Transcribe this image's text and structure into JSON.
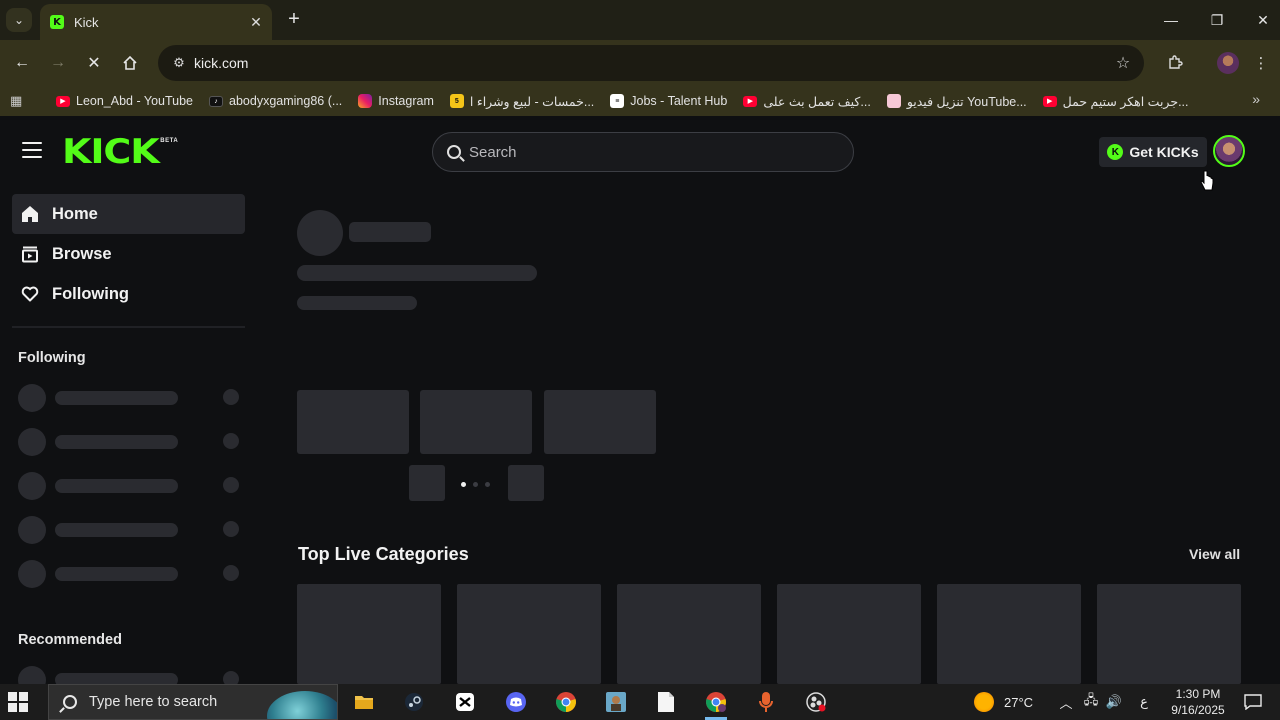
{
  "browser": {
    "tab_title": "Kick",
    "url": "kick.com",
    "bookmarks": [
      {
        "label": "Leon_Abd - YouTube",
        "icon": "youtube-icon"
      },
      {
        "label": "abodyxgaming86 (...",
        "icon": "tiktok-icon"
      },
      {
        "label": "Instagram",
        "icon": "instagram-icon"
      },
      {
        "label": "خمسات - لبيع وشراء ا...",
        "icon": "khamsat-icon"
      },
      {
        "label": "Jobs - Talent Hub",
        "icon": "jobs-icon"
      },
      {
        "label": "كيف تعمل بث على...",
        "icon": "youtube-icon"
      },
      {
        "label": "تنزيل فيديو YouTube...",
        "icon": "downloader-icon"
      },
      {
        "label": "جربت اهكر ستيم حمل...",
        "icon": "youtube-icon"
      }
    ]
  },
  "kick": {
    "logo_text": "KICK",
    "logo_badge": "BETA",
    "search_placeholder": "Search",
    "get_kicks_label": "Get KICKs",
    "nav": [
      {
        "label": "Home",
        "icon": "home-icon",
        "active": true
      },
      {
        "label": "Browse",
        "icon": "browse-icon",
        "active": false
      },
      {
        "label": "Following",
        "icon": "heart-icon",
        "active": false
      }
    ],
    "following_heading": "Following",
    "recommended_heading": "Recommended",
    "top_live_title": "Top Live Categories",
    "view_all_label": "View all",
    "carousel": {
      "dot_count": 3,
      "active_dot": 0
    }
  },
  "taskbar": {
    "search_placeholder": "Type here to search",
    "weather": "27°C",
    "ime_indicator": "ع",
    "time": "1:30 PM",
    "date": "9/16/2025"
  },
  "colors": {
    "kick_green": "#53fc18",
    "background": "#0f1012",
    "skeleton": "#2a2b30"
  }
}
